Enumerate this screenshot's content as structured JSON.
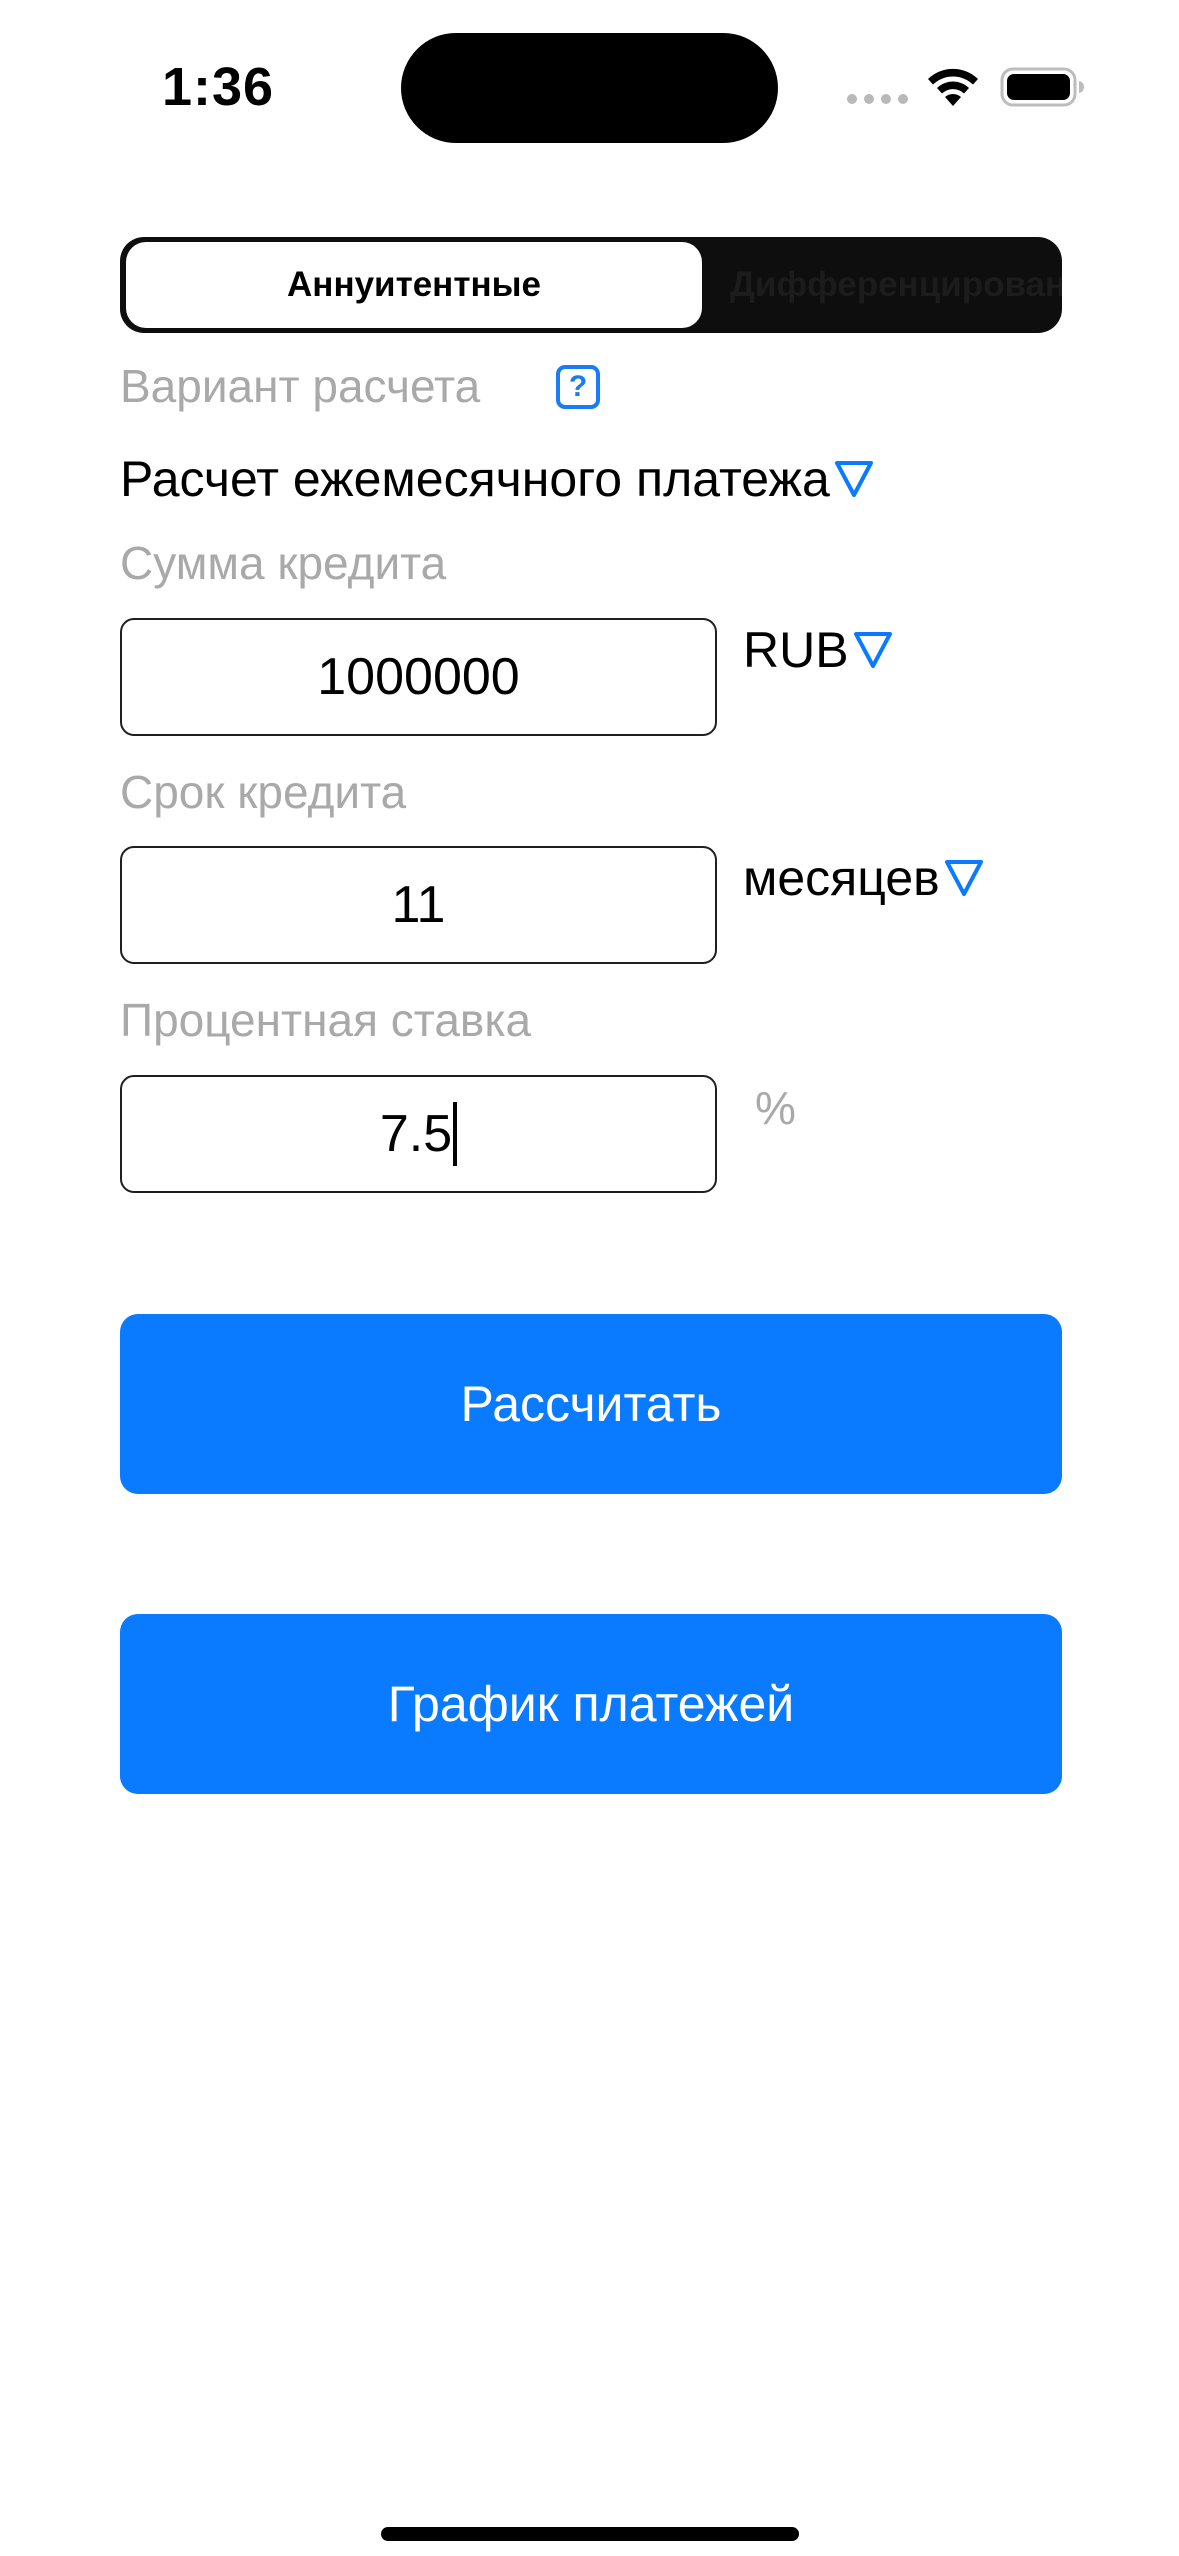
{
  "status_bar": {
    "time": "1:36"
  },
  "segmented_control": {
    "options": [
      "Аннуитентные",
      "Дифференцированные"
    ],
    "selected": "Аннуитентные"
  },
  "calc_variant": {
    "label": "Вариант расчета",
    "help_icon": "?",
    "value": "Расчет ежемесячного платежа"
  },
  "loan_amount": {
    "label": "Сумма кредита",
    "value": "1000000",
    "currency": "RUB"
  },
  "loan_term": {
    "label": "Срок кредита",
    "value": "11",
    "unit": "месяцев"
  },
  "interest_rate": {
    "label": "Процентная ставка",
    "value": "7.5",
    "unit": "%"
  },
  "buttons": {
    "calculate": "Рассчитать",
    "schedule": "График платежей"
  },
  "colors": {
    "accent": "#0a7afe",
    "label_gray": "#a9a9a9"
  }
}
